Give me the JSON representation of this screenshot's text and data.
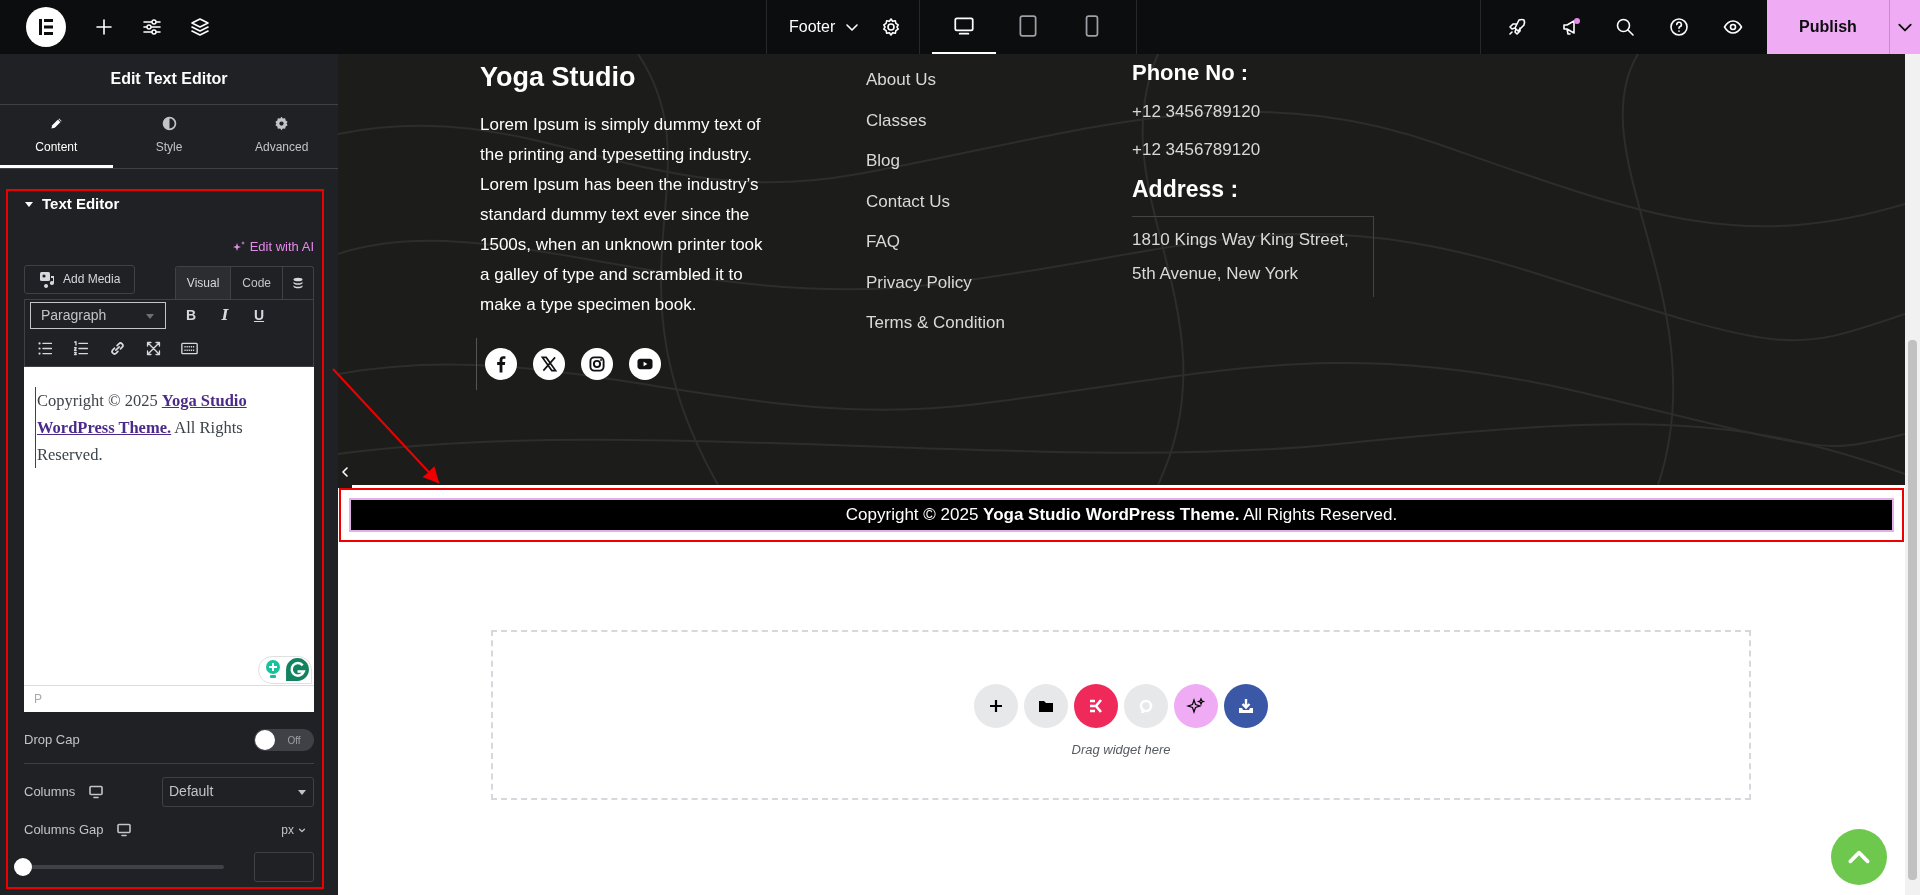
{
  "topbar": {
    "document": "Footer",
    "devices": [
      {
        "kind": "desktop",
        "selected": true
      },
      {
        "kind": "tablet",
        "selected": false
      },
      {
        "kind": "mobile",
        "selected": false
      }
    ],
    "publish": "Publish"
  },
  "panel": {
    "title": "Edit Text Editor",
    "tabs": [
      {
        "kind": "content",
        "label": "Content",
        "selected": true
      },
      {
        "kind": "style",
        "label": "Style",
        "selected": false
      },
      {
        "kind": "advanced",
        "label": "Advanced",
        "selected": false
      }
    ],
    "section": {
      "title": "Text Editor",
      "expanded": true
    },
    "edit_with_ai": "Edit with AI",
    "add_media": "Add Media",
    "editor_modes": [
      {
        "label": "Visual",
        "selected": true
      },
      {
        "label": "Code",
        "selected": false
      }
    ],
    "format": "Paragraph",
    "format_buttons": [
      "B",
      "I",
      "U"
    ],
    "content": "Copyright © 2025 **Yoga Studio WordPress Theme.** All Rights Reserved.",
    "path": "P",
    "drop_cap": {
      "label": "Drop Cap",
      "on": false,
      "state_text": "Off"
    },
    "columns": {
      "label": "Columns",
      "value": "Default"
    },
    "columns_gap": {
      "label": "Columns Gap",
      "unit": "px",
      "level": 0
    }
  },
  "footer": {
    "brand": "Yoga Studio",
    "about": "Lorem Ipsum is simply dummy text of the printing and typesetting industry. Lorem Ipsum has been the industry’s standard dummy text ever since the 1500s, when an unknown printer took a galley of type and scrambled it to make a type specimen book.",
    "socials": [
      {
        "kind": "facebook"
      },
      {
        "kind": "x"
      },
      {
        "kind": "instagram"
      },
      {
        "kind": "youtube"
      }
    ],
    "links": [
      "About Us",
      "Classes",
      "Blog",
      "Contact Us",
      "FAQ",
      "Privacy Policy",
      "Terms & Condition"
    ],
    "phone_heading": "Phone No :",
    "phones": [
      "+12 3456789120",
      "+12 3456789120"
    ],
    "address_heading": "Address :",
    "address_lines": [
      "1810 Kings Way King Street,",
      "5th Avenue, New York"
    ]
  },
  "copyright": "Copyright © 2025 **Yoga Studio WordPress Theme.** All Rights Reserved.",
  "drop_zone": {
    "actions": [
      {
        "kind": "add"
      },
      {
        "kind": "folder"
      },
      {
        "kind": "kit"
      },
      {
        "kind": "p"
      },
      {
        "kind": "ai"
      },
      {
        "kind": "download"
      }
    ],
    "hint": "Drag widget here"
  }
}
